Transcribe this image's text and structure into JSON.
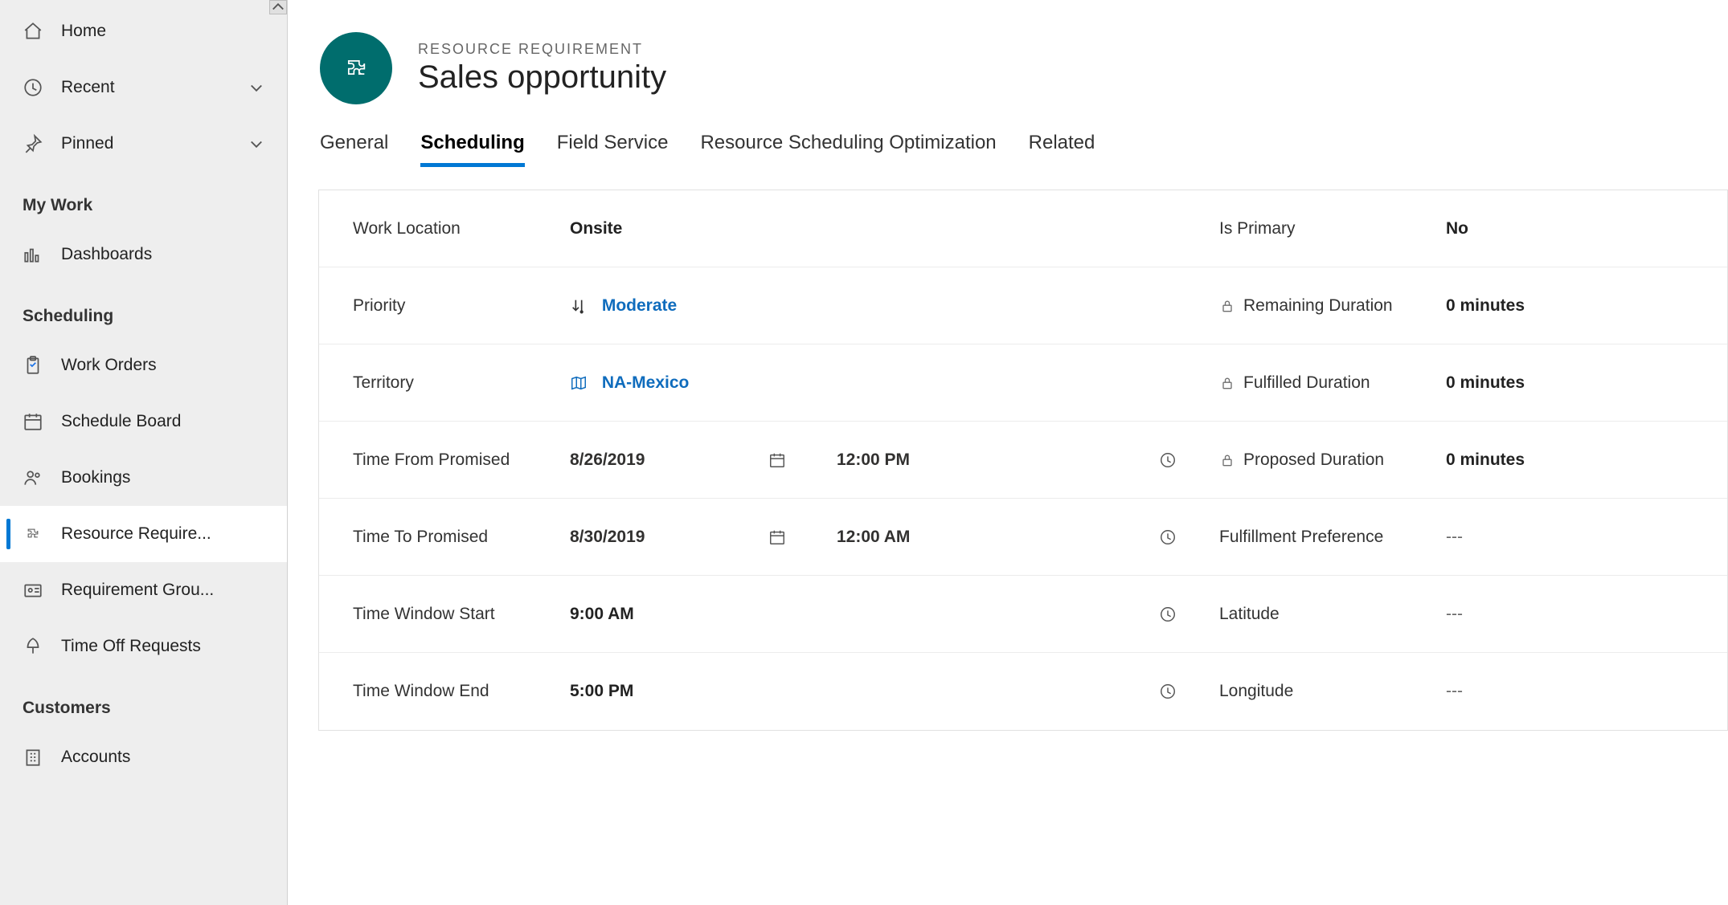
{
  "sidebar": {
    "top": {
      "home": "Home",
      "recent": "Recent",
      "pinned": "Pinned"
    },
    "sections": [
      {
        "title": "My Work",
        "items": [
          {
            "label": "Dashboards",
            "icon": "dashboard"
          }
        ]
      },
      {
        "title": "Scheduling",
        "items": [
          {
            "label": "Work Orders",
            "icon": "clipboard"
          },
          {
            "label": "Schedule Board",
            "icon": "calendar-board"
          },
          {
            "label": "Bookings",
            "icon": "people"
          },
          {
            "label": "Resource Require...",
            "icon": "gear-piece",
            "selected": true
          },
          {
            "label": "Requirement Grou...",
            "icon": "id-card"
          },
          {
            "label": "Time Off Requests",
            "icon": "timeoff"
          }
        ]
      },
      {
        "title": "Customers",
        "items": [
          {
            "label": "Accounts",
            "icon": "building"
          }
        ]
      }
    ]
  },
  "header": {
    "overline": "RESOURCE REQUIREMENT",
    "title": "Sales opportunity"
  },
  "tabs": [
    {
      "label": "General",
      "active": false
    },
    {
      "label": "Scheduling",
      "active": true
    },
    {
      "label": "Field Service",
      "active": false
    },
    {
      "label": "Resource Scheduling Optimization",
      "active": false
    },
    {
      "label": "Related",
      "active": false
    }
  ],
  "form": {
    "left": {
      "work_location": {
        "label": "Work Location",
        "value": "Onsite"
      },
      "priority": {
        "label": "Priority",
        "value": "Moderate"
      },
      "territory": {
        "label": "Territory",
        "value": "NA-Mexico"
      },
      "time_from_promised": {
        "label": "Time From Promised",
        "date": "8/26/2019",
        "time": "12:00 PM"
      },
      "time_to_promised": {
        "label": "Time To Promised",
        "date": "8/30/2019",
        "time": "12:00 AM"
      },
      "time_window_start": {
        "label": "Time Window Start",
        "value": "9:00 AM"
      },
      "time_window_end": {
        "label": "Time Window End",
        "value": "5:00 PM"
      }
    },
    "right": {
      "is_primary": {
        "label": "Is Primary",
        "value": "No"
      },
      "remaining_duration": {
        "label": "Remaining Duration",
        "value": "0 minutes"
      },
      "fulfilled_duration": {
        "label": "Fulfilled Duration",
        "value": "0 minutes"
      },
      "proposed_duration": {
        "label": "Proposed Duration",
        "value": "0 minutes"
      },
      "fulfillment_preference": {
        "label": "Fulfillment Preference",
        "value": "---"
      },
      "latitude": {
        "label": "Latitude",
        "value": "---"
      },
      "longitude": {
        "label": "Longitude",
        "value": "---"
      }
    }
  }
}
